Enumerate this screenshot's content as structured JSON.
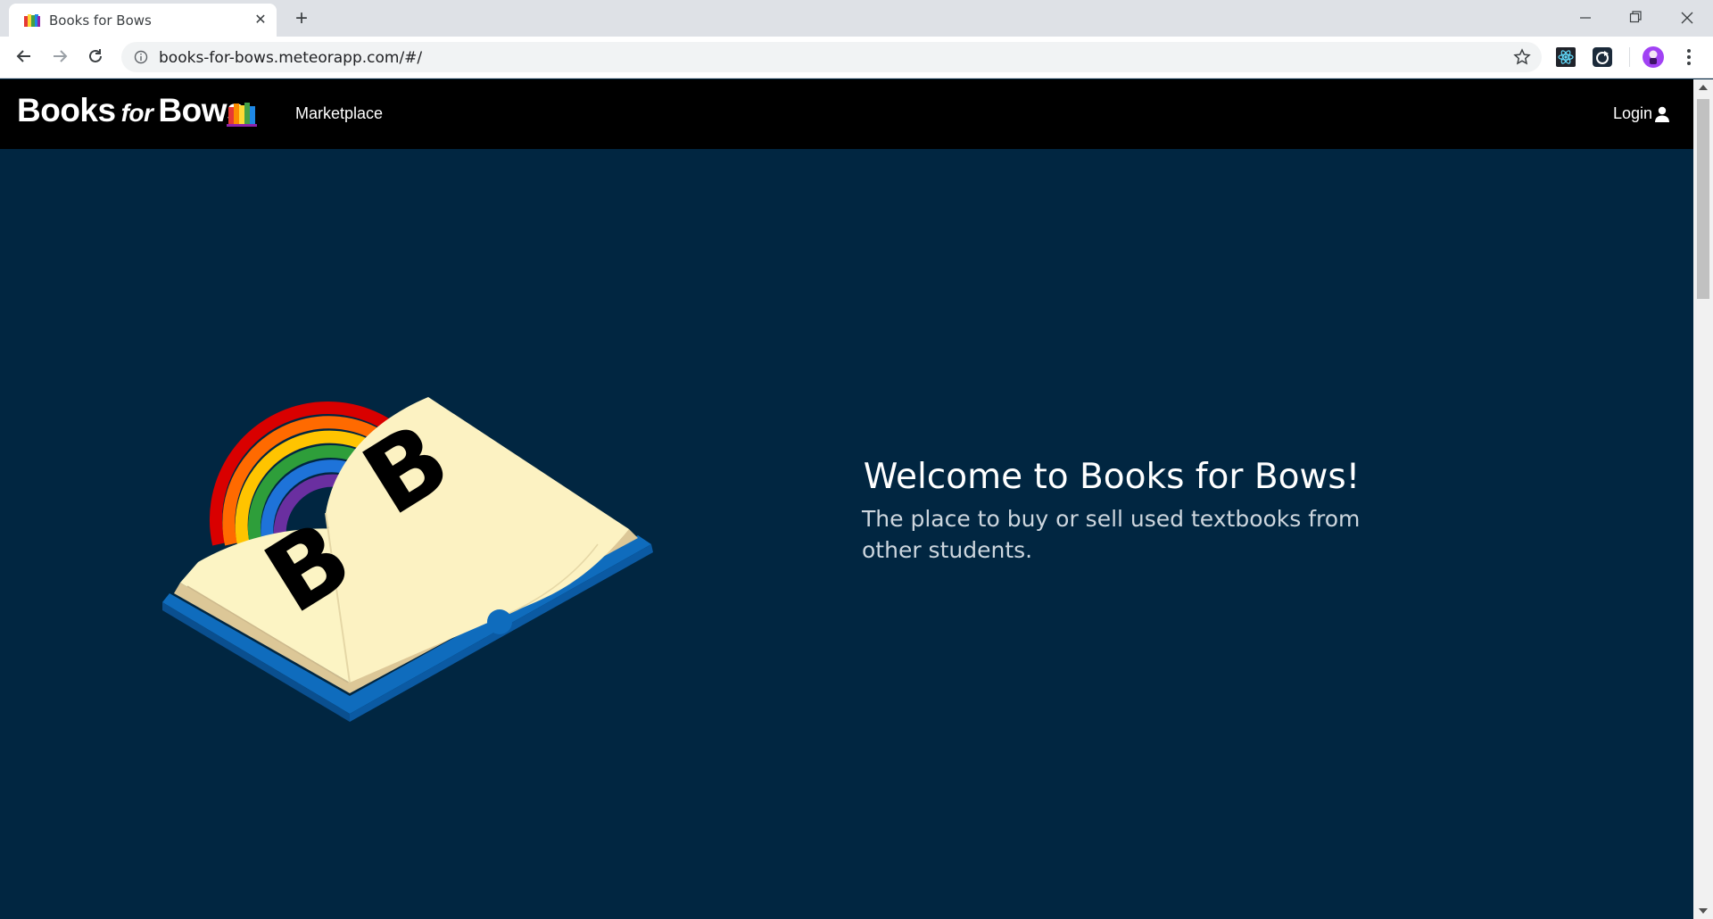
{
  "browser": {
    "tab_title": "Books for Bows",
    "tab_close": "✕",
    "new_tab": "+",
    "url": "books-for-bows.meteorapp.com/#/",
    "window_controls": [
      "minimize-icon",
      "restore-icon",
      "close-icon"
    ],
    "toolbar_icons": [
      "back-arrow-icon",
      "forward-arrow-icon",
      "reload-icon",
      "info-icon",
      "star-icon",
      "react-devtools-icon",
      "extension-icon",
      "profile-avatar-icon",
      "kebab-menu-icon"
    ]
  },
  "nav": {
    "brand_main_1": "Books",
    "brand_for": "for",
    "brand_main_2": "Bows",
    "marketplace": "Marketplace",
    "login": "Login",
    "login_icon": "user-icon"
  },
  "hero": {
    "title": "Welcome to Books for Bows!",
    "subtitle": "The place to buy or sell used textbooks from other students.",
    "illustration_letters": [
      "B",
      "B"
    ]
  },
  "colors": {
    "page_bg": "#012641",
    "navbar_bg": "#000000",
    "book_page": "#fcf4c4",
    "book_cover": "#0f6cbd"
  }
}
